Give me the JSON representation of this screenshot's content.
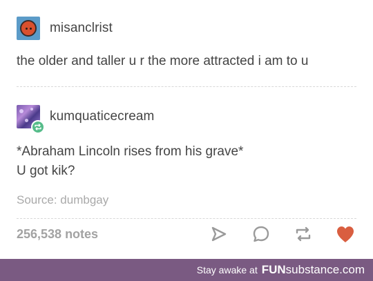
{
  "post1": {
    "username": "misanclrist",
    "text": "the older and taller u r the more attracted i am to u"
  },
  "post2": {
    "username": "kumquaticecream",
    "line1": "*Abraham Lincoln rises from his grave*",
    "line2": "U got kik?"
  },
  "source": "Source: dumbgay",
  "notes": "256,538 notes",
  "actions": {
    "share_icon": "share-arrow-icon",
    "reply_icon": "reply-bubble-icon",
    "reblog_icon": "reblog-icon",
    "like_icon": "heart-icon"
  },
  "colors": {
    "heart": "#d95e40",
    "icon_gray": "#9a9a9a",
    "reblog_badge": "#56bc8a",
    "banner": "#7a5a82"
  },
  "banner": {
    "prefix": "Stay awake at",
    "brand_bold": "FUN",
    "brand_rest": "substance.com"
  }
}
